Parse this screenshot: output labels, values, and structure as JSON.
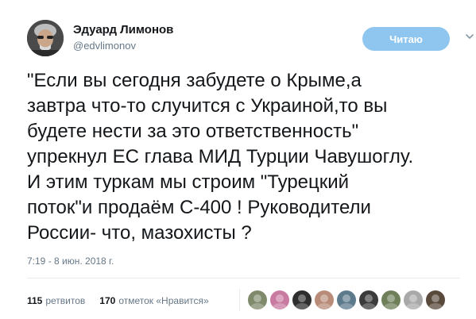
{
  "author": {
    "name": "Эдуард Лимонов",
    "handle": "@edvlimonov"
  },
  "follow_button_label": "Читаю",
  "tweet": {
    "lines": [
      "\"Если вы сегодня забудете о Крыме,а",
      "завтра что-то случится с Украиной,то вы",
      "будете нести за это ответственность\"",
      "упрекнул ЕС глава МИД Турции Чавушоглу.",
      "И этим туркам мы строим \"Турецкий",
      "поток\"и продаём С-400 ! Руководители",
      "России- что, мазохисты ?"
    ],
    "timestamp": "7:19 - 8 июн. 2018 г."
  },
  "stats": {
    "retweets_count": "115",
    "retweets_label": "ретвитов",
    "likes_count": "170",
    "likes_label": "отметок «Нравится»"
  },
  "likers": [
    {
      "icon": "liker-avatar",
      "color": "#7f8a6b"
    },
    {
      "icon": "liker-avatar",
      "color": "#c97aa0"
    },
    {
      "icon": "liker-avatar",
      "color": "#2e2e2e"
    },
    {
      "icon": "liker-avatar",
      "color": "#b98c7a"
    },
    {
      "icon": "liker-avatar",
      "color": "#5d7a8c"
    },
    {
      "icon": "liker-avatar",
      "color": "#3b3b3b"
    },
    {
      "icon": "liker-avatar",
      "color": "#6e7f5a"
    },
    {
      "icon": "liker-avatar",
      "color": "#a9a9a9"
    },
    {
      "icon": "liker-avatar",
      "color": "#5a4a3c"
    }
  ],
  "colors": {
    "follow_button_bg": "#8ec6ef",
    "secondary_text": "#657786",
    "primary_text": "#14171a"
  }
}
